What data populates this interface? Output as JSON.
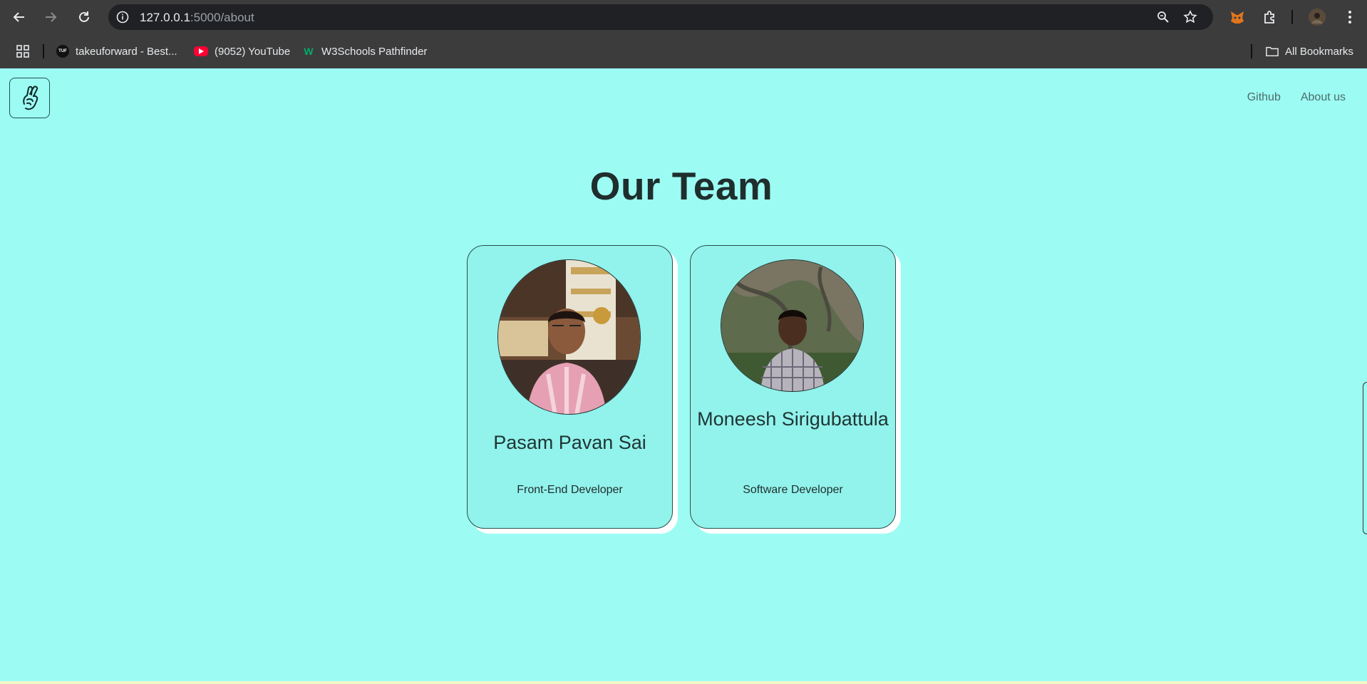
{
  "browser": {
    "url_host": "127.0.0.1",
    "url_path": ":5000/about",
    "bookmarks": [
      {
        "label": "takeuforward - Best...",
        "icon": "tuf-icon"
      },
      {
        "label": "(9052) YouTube",
        "icon": "youtube-icon"
      },
      {
        "label": "W3Schools Pathfinder",
        "icon": "w3schools-icon"
      }
    ],
    "all_bookmarks_label": "All Bookmarks"
  },
  "site": {
    "nav": [
      {
        "label": "Github"
      },
      {
        "label": "About us"
      }
    ]
  },
  "team": {
    "title": "Our Team",
    "members": [
      {
        "name": "Pasam Pavan Sai",
        "role": "Front-End Developer"
      },
      {
        "name": "Moneesh Sirigubattula",
        "role": "Software Developer"
      }
    ]
  },
  "colors": {
    "page_bg": "#9cfcf4",
    "card_bg": "#92f2ec",
    "chrome_bg": "#3c3c3c",
    "omnibox_bg": "#202124"
  }
}
